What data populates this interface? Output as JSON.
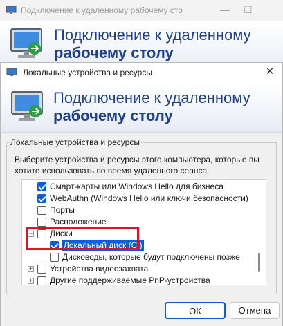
{
  "background_window": {
    "title": "Подключение к удаленному рабочему сто",
    "header_line1": "Подключение к удаленному",
    "header_line2": "рабочему столу"
  },
  "dialog": {
    "title": "Локальные устройства и ресурсы",
    "header_line1": "Подключение к удаленному",
    "header_line2": "рабочему столу",
    "group_label": "Локальные устройства и ресурсы",
    "description": "Выберите устройства и ресурсы этого компьютера, которые вы хотите использовать во время удаленного сеанса.",
    "tree": [
      {
        "label": "Смарт-карты или Windows Hello для бизнеса",
        "checked": true
      },
      {
        "label": "WebAuthn (Windows Hello или ключи безопасности)",
        "checked": true
      },
      {
        "label": "Порты",
        "checked": false
      },
      {
        "label": "Расположение",
        "checked": false
      },
      {
        "label": "Диски",
        "checked": false,
        "expander": "collapse"
      },
      {
        "label": "Локальный диск (C:)",
        "checked": true,
        "selected": true
      },
      {
        "label": "Дисководы, которые будут подключены позже",
        "checked": false
      },
      {
        "label": "Устройства видеозахвата",
        "checked": false,
        "expander": "expand"
      },
      {
        "label": "Другие поддерживаемые PnP-устройства",
        "checked": false,
        "expander": "expand"
      }
    ],
    "ok_label": "ОК",
    "cancel_label": "Отмена"
  },
  "colors": {
    "accent": "#0b5ed7",
    "header_text": "#1f3f8a",
    "highlight_border": "#e0121a"
  },
  "icons": [
    "remote-desktop-icon",
    "close-icon",
    "minimize-icon",
    "maximize-icon"
  ]
}
